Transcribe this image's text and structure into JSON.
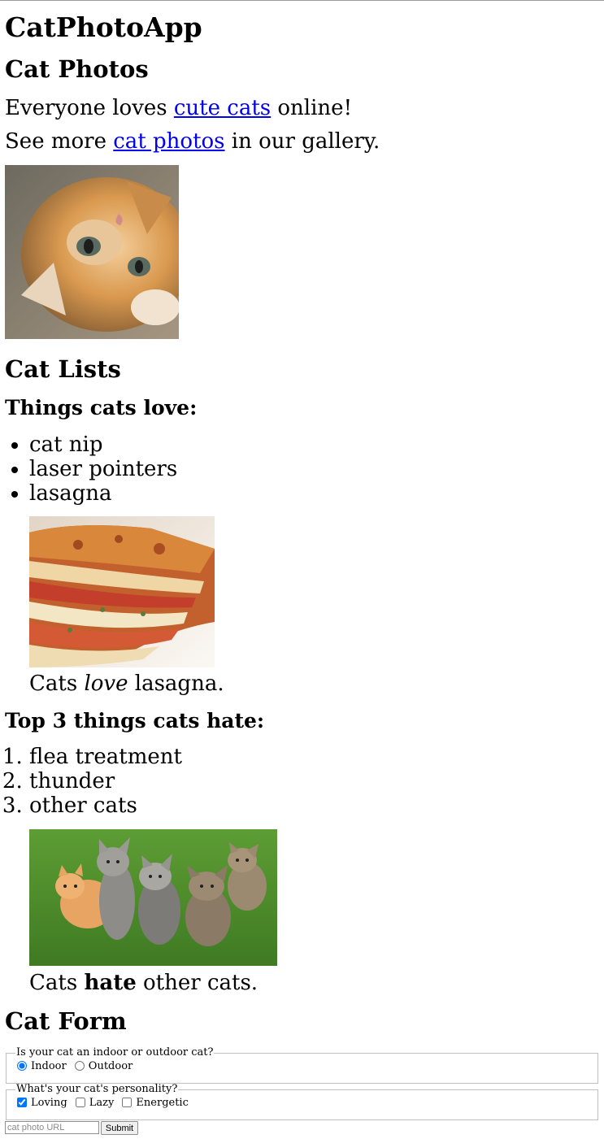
{
  "page": {
    "title": "CatPhotoApp"
  },
  "photos_section": {
    "heading": "Cat Photos",
    "line1": {
      "before": "Everyone loves ",
      "link": "cute cats",
      "after": " online!"
    },
    "line2": {
      "before": "See more ",
      "link": "cat photos",
      "after": " in our gallery."
    }
  },
  "lists_section": {
    "heading": "Cat Lists",
    "love_heading": "Things cats love:",
    "love_items": [
      "cat nip",
      "laser pointers",
      "lasagna"
    ],
    "love_caption": {
      "before": "Cats ",
      "emphasis": "love",
      "after": " lasagna."
    },
    "hate_heading": "Top 3 things cats hate:",
    "hate_items": [
      "flea treatment",
      "thunder",
      "other cats"
    ],
    "hate_caption": {
      "before": "Cats ",
      "strong": "hate",
      "after": " other cats."
    }
  },
  "form_section": {
    "heading": "Cat Form",
    "location_legend": "Is your cat an indoor or outdoor cat?",
    "location_options": [
      {
        "label": "Indoor",
        "checked": true
      },
      {
        "label": "Outdoor",
        "checked": false
      }
    ],
    "personality_legend": "What's your cat's personality?",
    "personality_options": [
      {
        "label": "Loving",
        "checked": true
      },
      {
        "label": "Lazy",
        "checked": false
      },
      {
        "label": "Energetic",
        "checked": false
      }
    ],
    "url_placeholder": "cat photo URL",
    "submit_label": "Submit"
  }
}
